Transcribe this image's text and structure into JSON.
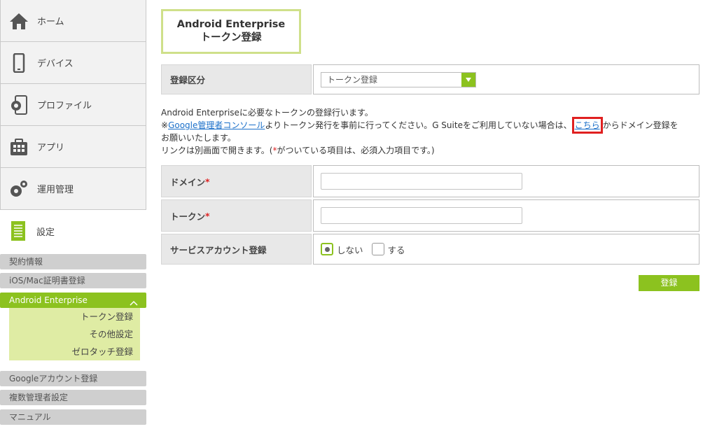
{
  "sidebar": {
    "nav": [
      {
        "label": "ホーム",
        "icon": "home-icon"
      },
      {
        "label": "デバイス",
        "icon": "device-icon"
      },
      {
        "label": "プロファイル",
        "icon": "profile-icon"
      },
      {
        "label": "アプリ",
        "icon": "app-icon"
      },
      {
        "label": "運用管理",
        "icon": "gears-icon"
      },
      {
        "label": "設定",
        "icon": "settings-doc-icon"
      }
    ],
    "sub": [
      {
        "label": "契約情報"
      },
      {
        "label": "iOS/Mac証明書登録"
      },
      {
        "label": "Android Enterprise"
      },
      {
        "label": "Googleアカウント登録"
      },
      {
        "label": "複数管理者設定"
      },
      {
        "label": "マニュアル"
      }
    ],
    "android_sub": [
      {
        "label": "トークン登録"
      },
      {
        "label": "その他設定"
      },
      {
        "label": "ゼロタッチ登録"
      }
    ]
  },
  "page": {
    "title_line1": "Android Enterprise",
    "title_line2": "トークン登録"
  },
  "form": {
    "category_label": "登録区分",
    "category_value": "トークン登録",
    "domain_label": "ドメイン",
    "token_label": "トークン",
    "required_mark": "*",
    "service_label": "サービスアカウント登録",
    "radio_no": "しない",
    "radio_yes": "する",
    "submit": "登録"
  },
  "desc": {
    "line1": "Android Enterpriseに必要なトークンの登録行います。",
    "prefix": "※",
    "link1": "Google管理者コンソール",
    "mid": "よりトークン発行を事前に行ってください。G Suiteをご利用していない場合は、",
    "link2": "こちら",
    "suffix": "からドメイン登録を",
    "line3": "お願いいたします。",
    "line4_a": "リンクは別画面で開きます。(",
    "line4_star": "*",
    "line4_b": "がついている項目は、必須入力項目です。)"
  },
  "colors": {
    "accent": "#8cc21f",
    "highlight": "#e02020"
  }
}
